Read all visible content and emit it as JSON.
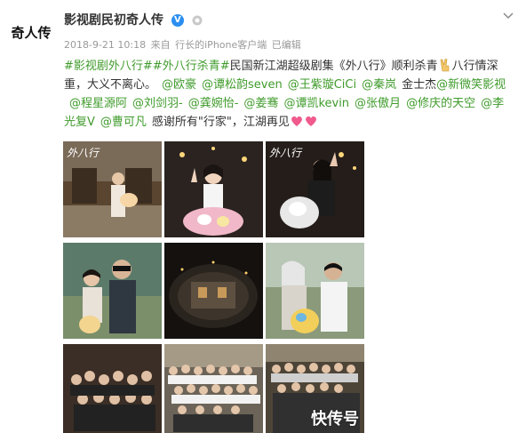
{
  "post": {
    "author": "影视剧民初奇人传",
    "avatar_label": "奇人传",
    "meta": {
      "time": "2018-9-21 10:18",
      "source_prefix": "来自",
      "source": "行长的iPhone客户端",
      "edited": "已编辑"
    },
    "content": {
      "hashtag1": "#影视剧外八行#",
      "hashtag2": "#外八行杀青#",
      "text1": "民国新江湖超级剧集《外八行》顺利杀青",
      "text2": "八行情深重，大义不离心。",
      "mentions1": [
        "@欧豪",
        "@谭松韵seven",
        "@王紫璇CiCi",
        "@秦岚"
      ],
      "plain_name": "金士杰",
      "mentions2": [
        "@新微笑影视",
        "@程星源阿",
        "@刘剑羽-",
        "@龚婉怡-",
        "@姜骞",
        "@谭凯kevin",
        "@张傲月",
        "@修庆的天空",
        "@李光复V",
        "@曹可凡"
      ],
      "text3": "感谢所有\"行家\"，江湖再见"
    },
    "photos": [
      {
        "name": "photo-1",
        "caption": "外八行"
      },
      {
        "name": "photo-2",
        "caption": ""
      },
      {
        "name": "photo-3",
        "caption": "外八行"
      },
      {
        "name": "photo-4",
        "caption": ""
      },
      {
        "name": "photo-5",
        "caption": ""
      },
      {
        "name": "photo-6",
        "caption": ""
      },
      {
        "name": "photo-7",
        "caption": ""
      },
      {
        "name": "photo-8",
        "caption": ""
      },
      {
        "name": "photo-9",
        "caption": ""
      }
    ],
    "watermark": "快传号"
  },
  "colors": {
    "link": "#3f9b2b",
    "verified": "#2b8ff0",
    "meta": "#999999"
  },
  "icons": [
    "verified-icon",
    "level-icon",
    "chevron-down-icon",
    "victory-hand-icon",
    "sparkling-heart-icon"
  ]
}
